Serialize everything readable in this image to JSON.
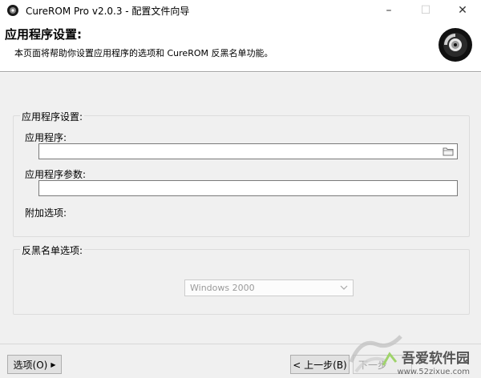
{
  "window": {
    "title": "CureROM Pro v2.0.3 - 配置文件向导",
    "minimize": "–",
    "maximize": "☐",
    "close": "✕"
  },
  "header": {
    "title": "应用程序设置:",
    "subtitle": "本页面将帮助你设置应用程序的选项和 CureROM 反黑名单功能。"
  },
  "app_group": {
    "label": "应用程序设置:",
    "app_label": "应用程序:",
    "app_value": "",
    "params_label": "应用程序参数:",
    "params_value": "",
    "extra_label": "附加选项:"
  },
  "blacklist_group": {
    "label": "反黑名单选项:",
    "os_select": "Windows 2000"
  },
  "footer": {
    "options_btn": "选项(O)",
    "back_btn": "< 上一步(B)",
    "next_btn": "下一步"
  },
  "watermark": {
    "main": "吾爱软件园",
    "url": "www.52zixue.com"
  },
  "colors": {
    "content_bg": "#f0f0f0",
    "header_bg": "#ffffff",
    "button_bg": "#e1e1e1"
  }
}
